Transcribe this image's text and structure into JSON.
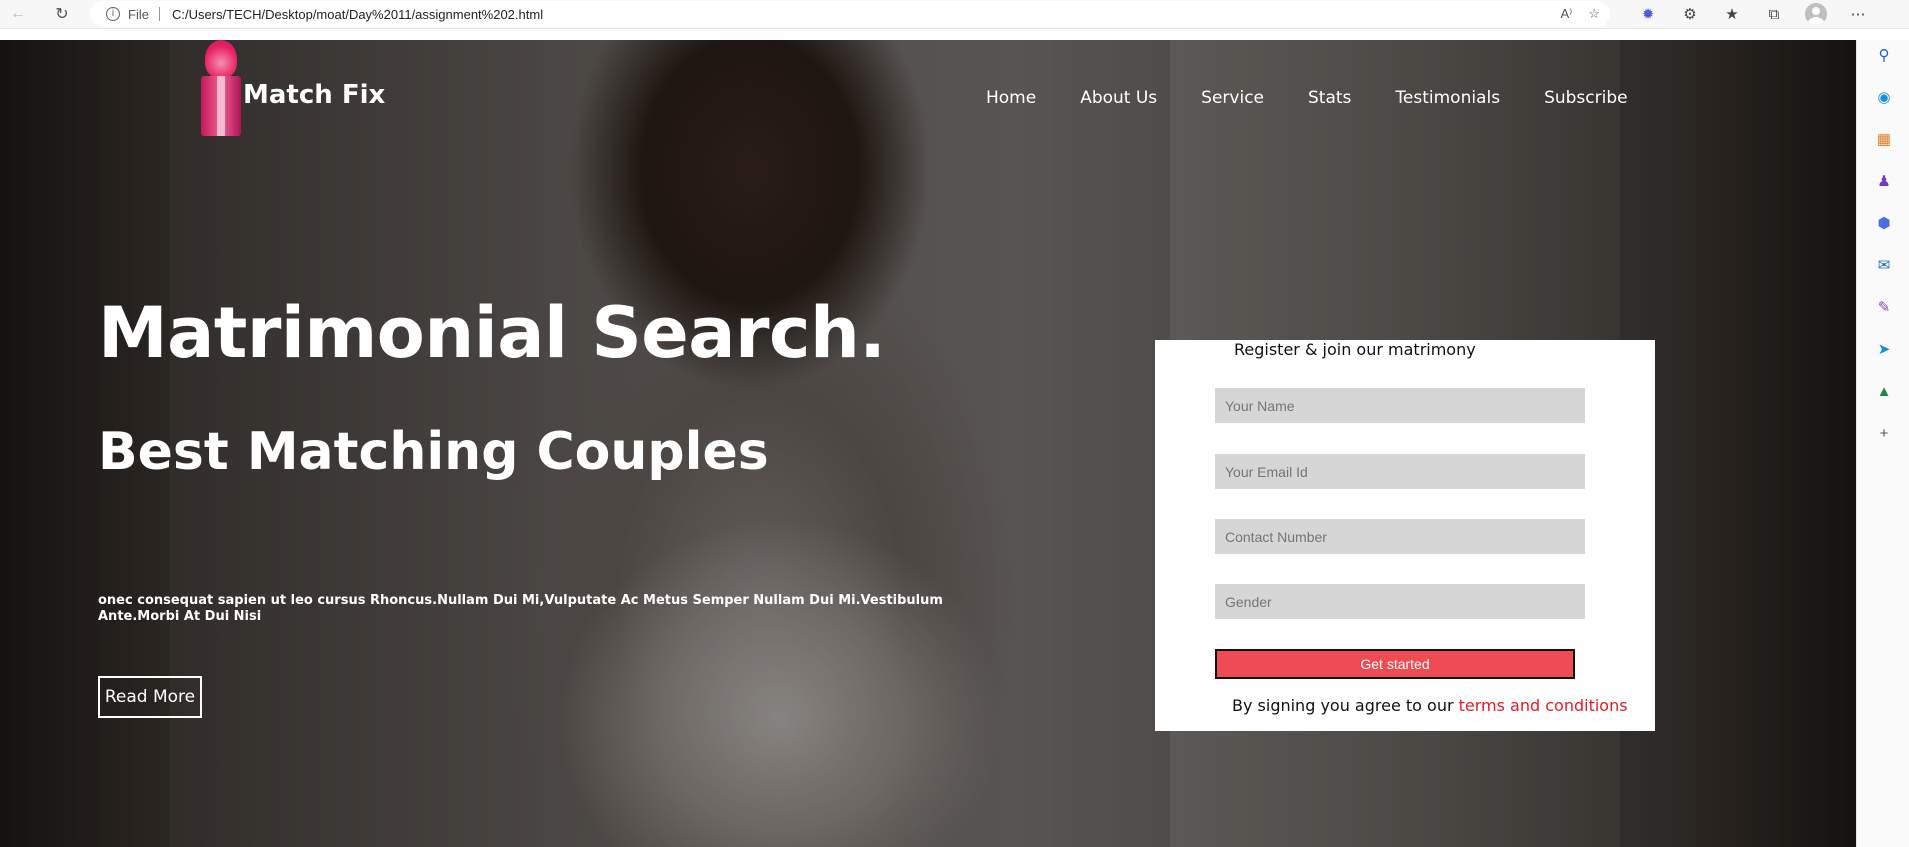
{
  "browser": {
    "file_label": "File",
    "url": "C:/Users/TECH/Desktop/moat/Day%2011/assignment%202.html",
    "icons": [
      "back-arrow-icon",
      "reload-icon",
      "info-icon",
      "read-aloud-icon",
      "favorites-add-icon",
      "copilot-icon",
      "extensions-icon",
      "favorites-icon",
      "collections-icon",
      "profile-icon",
      "more-icon"
    ]
  },
  "sidebar_icons": [
    "search-icon",
    "bing-icon",
    "tools-icon",
    "games-icon",
    "office-icon",
    "outlook-icon",
    "designer-icon",
    "send-icon",
    "tree-icon",
    "add-icon"
  ],
  "site": {
    "brand": "Match Fix",
    "nav": [
      "Home",
      "About Us",
      "Service",
      "Stats",
      "Testimonials",
      "Subscribe"
    ],
    "headline": "Matrimonial Search.",
    "subheadline": "Best Matching Couples",
    "lead": "onec consequat sapien ut leo cursus Rhoncus.Nullam Dui Mi,Vulputate Ac Metus Semper Nullam Dui Mi.Vestibulum Ante.Morbi At Dui Nisi",
    "read_more": "Read More"
  },
  "form": {
    "title": "Register & join our matrimony",
    "name_placeholder": "Your Name",
    "email_placeholder": "Your Email Id",
    "phone_placeholder": "Contact Number",
    "gender_placeholder": "Gender",
    "submit": "Get started",
    "agree_text": "By signing you agree to our ",
    "terms_link": "terms and conditions"
  },
  "colors": {
    "accent": "#ee4b52",
    "link": "#e31b23",
    "field_bg": "#d6d6d6"
  }
}
